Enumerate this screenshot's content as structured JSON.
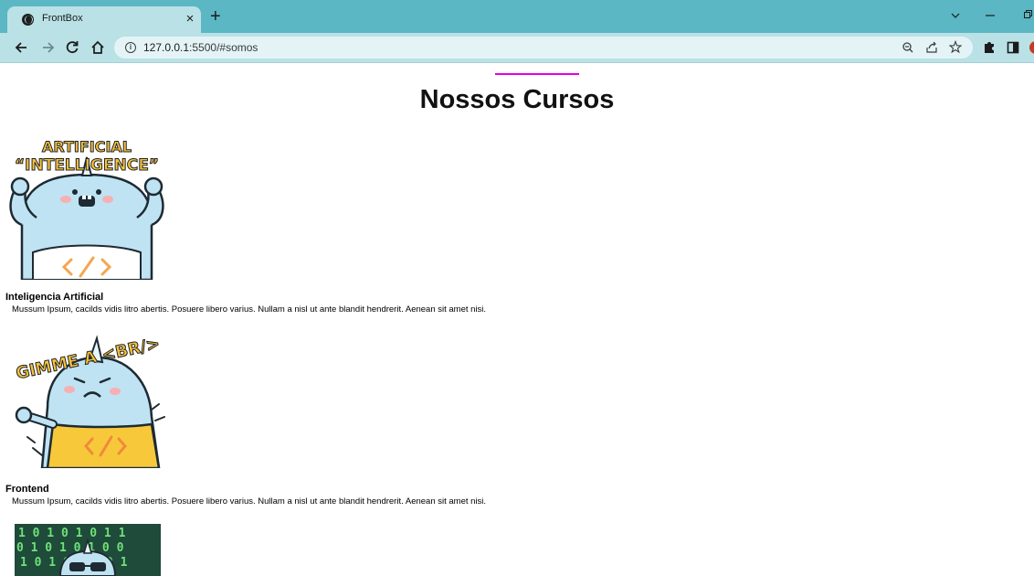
{
  "browser": {
    "tab_title": "FrontBox",
    "tab_close": "×",
    "new_tab": "+",
    "url_host": "127.0.0.1",
    "url_rest": ":5500/#somos",
    "icons": [
      "globe-icon",
      "back-arrow-icon",
      "forward-arrow-icon",
      "reload-icon",
      "home-icon",
      "info-icon",
      "zoom-icon",
      "share-icon",
      "star-icon",
      "extensions-icon",
      "sidebar-icon",
      "minimize-icon",
      "maximize-icon",
      "chevron-down-icon"
    ],
    "tab_bar_color": "#5ab7c3",
    "toolbar_color": "#b9e1e6"
  },
  "page": {
    "title": "Nossos Cursos",
    "accent_color": "#e000e8",
    "courses": [
      {
        "badge": "ARTIFICIAL “INTELLIGENCE”",
        "name": "Inteligencia Artificial",
        "description": "Mussum Ipsum, cacilds vidis litro abertis. Posuere libero varius. Nullam a nisl ut ante blandit hendrerit. Aenean sit amet nisi."
      },
      {
        "badge": "GIMME A <BR/>",
        "name": "Frontend",
        "description": "Mussum Ipsum, cacilds vidis litro abertis. Posuere libero varius. Nullam a nisl ut ante blandit hendrerit. Aenean sit amet nisi."
      },
      {
        "badge": ""
      }
    ]
  }
}
